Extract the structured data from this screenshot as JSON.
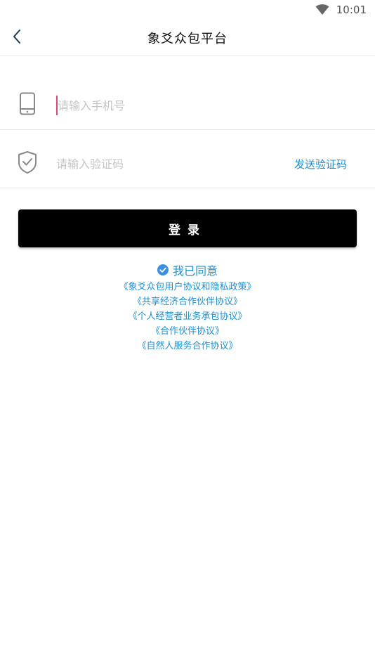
{
  "status_bar": {
    "time": "10:01",
    "wifi_icon": "wifi-icon"
  },
  "header": {
    "back_icon": "chevron-left-icon",
    "title": "象爻众包平台"
  },
  "form": {
    "phone": {
      "icon": "phone-icon",
      "placeholder": "请输入手机号",
      "value": ""
    },
    "code": {
      "icon": "shield-check-icon",
      "placeholder": "请输入验证码",
      "value": "",
      "send_label": "发送验证码"
    }
  },
  "login": {
    "label": "登录",
    "bg_color": "#000000",
    "text_color": "#ffffff"
  },
  "agreement": {
    "check_icon": "check-circle-icon",
    "agree_label": "我已同意",
    "links": [
      "《象爻众包用户协议和隐私政策》",
      "《共享经济合作伙伴协议》",
      "《个人经营者业务承包协议》",
      "《合作伙伴协议》",
      "《自然人服务合作协议》"
    ]
  },
  "colors": {
    "accent": "#1f8fd0",
    "cursor": "#e0457b",
    "placeholder": "#c4c4c4"
  }
}
